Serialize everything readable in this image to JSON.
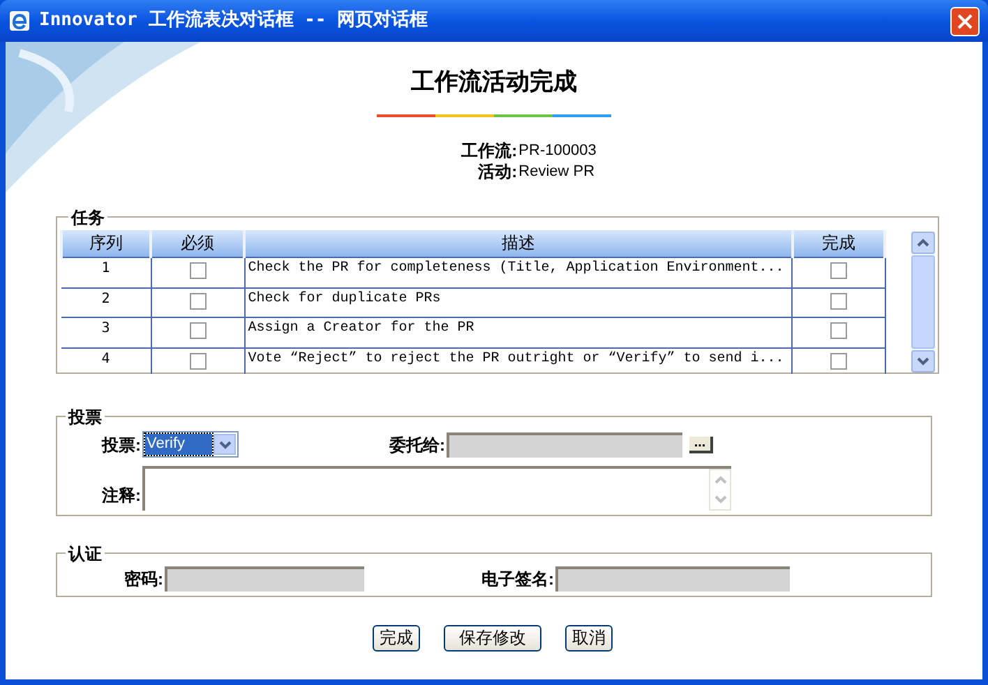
{
  "window": {
    "title": "Innovator 工作流表决对话框 -- 网页对话框"
  },
  "heading": "工作流活动完成",
  "info": [
    {
      "label": "工作流:",
      "value": "PR-100003"
    },
    {
      "label": "活动:",
      "value": "Review PR"
    }
  ],
  "tasks": {
    "legend": "任务",
    "columns": [
      "序列",
      "必须",
      "描述",
      "完成"
    ],
    "rows": [
      {
        "seq": "1",
        "required": false,
        "description": "Check the PR for completeness (Title, Application Environment...",
        "done": false
      },
      {
        "seq": "2",
        "required": false,
        "description": "Check for duplicate PRs",
        "done": false
      },
      {
        "seq": "3",
        "required": false,
        "description": "Assign a Creator for the PR",
        "done": false
      },
      {
        "seq": "4",
        "required": false,
        "description": "Vote “Reject” to reject the PR outright or “Verify” to send i...",
        "done": false
      }
    ]
  },
  "vote": {
    "legend": "投票",
    "vote_label": "投票:",
    "vote_value": "Verify",
    "delegate_label": "委托给:",
    "delegate_button": "...",
    "comment_label": "注释:"
  },
  "auth": {
    "legend": "认证",
    "password_label": "密码:",
    "signature_label": "电子签名:"
  },
  "buttons": [
    "完成",
    "保存修改",
    "取消"
  ]
}
